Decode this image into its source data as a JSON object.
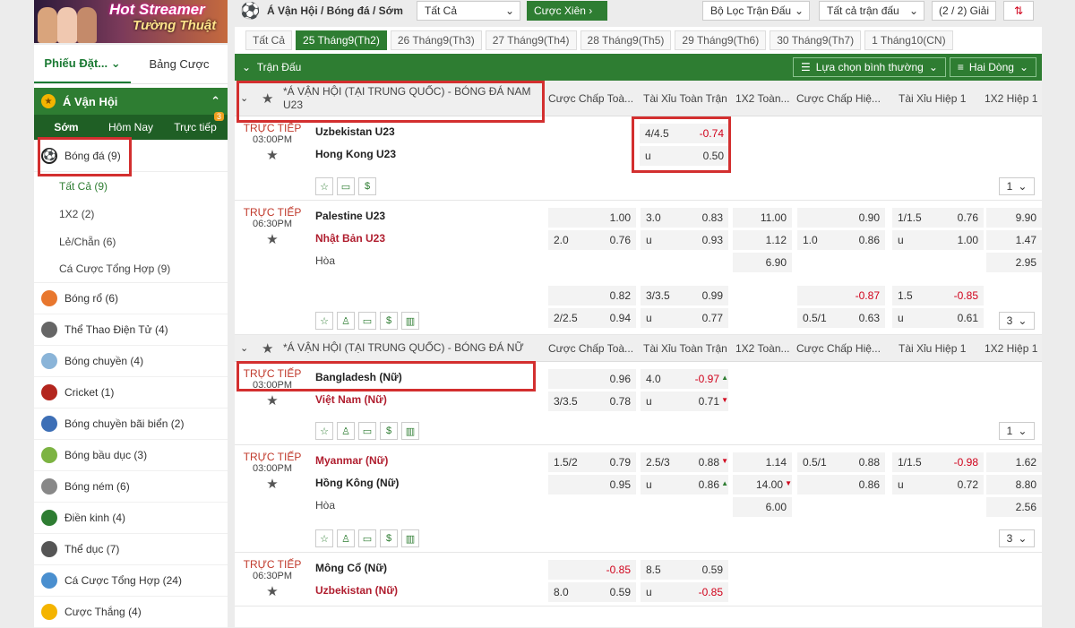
{
  "banner": {
    "line1": "Hot Streamer",
    "line2": "Tường Thuật"
  },
  "topbar": {
    "title": "Á Vận Hội / Bóng đá / Sớm",
    "filter_all": "Tất Cả",
    "parlay": "Cược Xiên",
    "match_filter": "Bộ Lọc Trận Đấu",
    "all_matches": "Tất cả trận đấu",
    "leagues": "(2 / 2) Giải"
  },
  "sidebar": {
    "tabs": [
      "Phiếu Đặt...",
      "Bảng Cược"
    ],
    "region": "Á Vận Hội",
    "subtabs": [
      "Sớm",
      "Hôm Nay",
      "Trực tiếp"
    ],
    "live_badge": "3",
    "football": "Bóng đá",
    "football_count": "(9)",
    "subitems": [
      {
        "label": "Tất Cả",
        "count": "(9)"
      },
      {
        "label": "1X2",
        "count": "(2)"
      },
      {
        "label": "Lẻ/Chẵn",
        "count": "(6)"
      },
      {
        "label": "Cá Cược Tổng Hợp",
        "count": "(9)"
      }
    ],
    "sports": [
      {
        "label": "Bóng rổ",
        "count": "(6)",
        "icon": "basketball-icon",
        "color": "#e8772e"
      },
      {
        "label": "Thể Thao Điện Tử",
        "count": "(4)",
        "icon": "headset-icon",
        "color": "#666"
      },
      {
        "label": "Bóng chuyền",
        "count": "(4)",
        "icon": "volleyball-icon",
        "color": "#8ab4d8"
      },
      {
        "label": "Cricket",
        "count": "(1)",
        "icon": "cricket-icon",
        "color": "#b3261e"
      },
      {
        "label": "Bóng chuyền bãi biển",
        "count": "(2)",
        "icon": "beach-volleyball-icon",
        "color": "#3d6fb6"
      },
      {
        "label": "Bóng bầu dục",
        "count": "(3)",
        "icon": "rugby-icon",
        "color": "#7cb342"
      },
      {
        "label": "Bóng ném",
        "count": "(6)",
        "icon": "handball-icon",
        "color": "#888"
      },
      {
        "label": "Điền kinh",
        "count": "(4)",
        "icon": "athletics-icon",
        "color": "#2e7d32"
      },
      {
        "label": "Thể dục",
        "count": "(7)",
        "icon": "gymnastics-icon",
        "color": "#555"
      },
      {
        "label": "Cá Cược Tổng Hợp",
        "count": "(24)",
        "icon": "combo-icon",
        "color": "#4a8fcf"
      },
      {
        "label": "Cược Thắng",
        "count": "(4)",
        "icon": "trophy-icon",
        "color": "#f4b400"
      }
    ]
  },
  "dates": [
    "Tất Cả",
    "25 Tháng9(Th2)",
    "26 Tháng9(Th3)",
    "27 Tháng9(Th4)",
    "28 Tháng9(Th5)",
    "29 Tháng9(Th6)",
    "30 Tháng9(Th7)",
    "1 Tháng10(CN)"
  ],
  "greenbar": {
    "title": "Trận Đấu",
    "select_mode": "Lựa chọn bình thường",
    "rows_mode": "Hai Dòng"
  },
  "columns": [
    "Cược Chấp Toà...",
    "Tài Xỉu Toàn Trận",
    "1X2 Toàn...",
    "Cược Chấp Hiệ...",
    "Tài Xỉu Hiệp 1",
    "1X2 Hiệp 1"
  ],
  "league1": "*Á VẬN HỘI (TẠI TRUNG QUỐC) - BÓNG ĐÁ NAM U23",
  "league2": "*Á VẬN HỘI (TẠI TRUNG QUỐC) - BÓNG ĐÁ NỮ",
  "live_label": "TRỰC TIẾP",
  "draw": "Hòa",
  "m1": {
    "time": "03:00PM",
    "home": "Uzbekistan U23",
    "away": "Hong Kong U23",
    "ou_line": "4/4.5",
    "ou_over": "-0.74",
    "u": "u",
    "ou_under": "0.50",
    "count": "1"
  },
  "m2": {
    "time": "06:30PM",
    "home": "Palestine U23",
    "away": "Nhật Bản U23",
    "r1": [
      "",
      "1.00",
      "3.0",
      "0.83",
      "11.00",
      "",
      "0.90",
      "1/1.5",
      "0.76",
      "9.90"
    ],
    "r2": [
      "2.0",
      "0.76",
      "u",
      "0.93",
      "1.12",
      "1.0",
      "0.86",
      "u",
      "1.00",
      "1.47"
    ],
    "x1": "6.90",
    "x2": "2.95",
    "a1": [
      "",
      "0.82",
      "3/3.5",
      "0.99",
      "",
      "-0.87",
      "1.5",
      "-0.85"
    ],
    "a2": [
      "2/2.5",
      "0.94",
      "u",
      "0.77",
      "0.5/1",
      "0.63",
      "u",
      "0.61"
    ],
    "count": "3"
  },
  "m3": {
    "time": "03:00PM",
    "home": "Bangladesh (Nữ)",
    "away": "Việt Nam (Nữ)",
    "r1": [
      "",
      "0.96",
      "4.0",
      "-0.97"
    ],
    "r2": [
      "3/3.5",
      "0.78",
      "u",
      "0.71"
    ],
    "count": "1"
  },
  "m4": {
    "time": "03:00PM",
    "home": "Myanmar (Nữ)",
    "away": "Hồng Kông (Nữ)",
    "r1": [
      "1.5/2",
      "0.79",
      "2.5/3",
      "0.88",
      "1.14",
      "0.5/1",
      "0.88",
      "1/1.5",
      "-0.98",
      "1.62"
    ],
    "r2": [
      "",
      "0.95",
      "u",
      "0.86",
      "14.00",
      "",
      "0.86",
      "u",
      "0.72",
      "8.80"
    ],
    "x1": "6.00",
    "x2": "2.56",
    "count": "3"
  },
  "m5": {
    "time": "06:30PM",
    "home": "Mông Cổ (Nữ)",
    "away": "Uzbekistan (Nữ)",
    "r1": [
      "",
      "-0.85",
      "8.5",
      "0.59"
    ],
    "r2": [
      "8.0",
      "0.59",
      "u",
      "-0.85"
    ]
  }
}
